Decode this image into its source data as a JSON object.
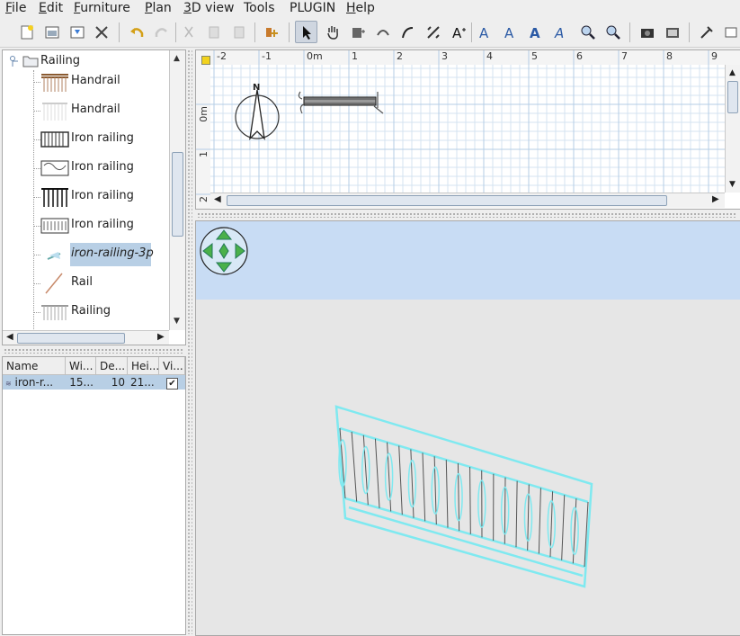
{
  "menu": {
    "items": [
      {
        "key": "F",
        "rest": "ile"
      },
      {
        "key": "E",
        "rest": "dit"
      },
      {
        "key": "F",
        "rest": "urniture"
      },
      {
        "key": "P",
        "rest": "lan"
      },
      {
        "key": "3",
        "rest": "D view"
      },
      {
        "key": "",
        "rest": "Tools"
      },
      {
        "key": "",
        "rest": "PLUGIN"
      },
      {
        "key": "H",
        "rest": "elp"
      }
    ]
  },
  "toolbar": {
    "icons": [
      "new-file-icon",
      "open-icon",
      "save-icon",
      "preferences-icon",
      "undo-icon",
      "redo-icon",
      "cut-icon",
      "copy-icon",
      "paste-icon",
      "add-furniture-icon",
      "select-icon",
      "pan-icon",
      "create-walls-icon",
      "create-rooms-icon",
      "create-polylines-icon",
      "create-dimensions-icon",
      "add-text-icon",
      "increase-text-size-icon",
      "decrease-text-size-icon",
      "bold-text-icon",
      "italic-text-icon",
      "zoom-in-icon",
      "zoom-out-icon",
      "create-photo-icon",
      "create-video-icon",
      "plugin-tool-icon"
    ]
  },
  "catalog": {
    "category": "Railing",
    "items": [
      {
        "label": "Handrail",
        "style": "normal"
      },
      {
        "label": "Handrail",
        "style": "normal"
      },
      {
        "label": "Iron railing",
        "style": "normal"
      },
      {
        "label": "Iron railing",
        "style": "normal"
      },
      {
        "label": "Iron railing",
        "style": "normal"
      },
      {
        "label": "Iron railing",
        "style": "normal"
      },
      {
        "label": "iron-railing-3p",
        "style": "selected"
      },
      {
        "label": "Rail",
        "style": "normal"
      },
      {
        "label": "Railing",
        "style": "normal"
      }
    ]
  },
  "furniture_table": {
    "headers": [
      "Name",
      "Wi...",
      "De...",
      "Hei...",
      "Vi..."
    ],
    "row": {
      "name": "iron-r...",
      "width": "15...",
      "depth": "10",
      "height": "21...",
      "visible": "✔"
    }
  },
  "plan": {
    "x_ticks": [
      "-2",
      "-1",
      "0m",
      "1",
      "2",
      "3",
      "4",
      "5",
      "6",
      "7",
      "8",
      "9"
    ],
    "y_ticks": [
      "0m",
      "1",
      "2"
    ],
    "compass_label": "N"
  },
  "colors": {
    "selection": "#b8cfe5",
    "sky": "#c8dcf4",
    "ground": "#e6e6e6",
    "railing_highlight": "#7fe9f0"
  }
}
